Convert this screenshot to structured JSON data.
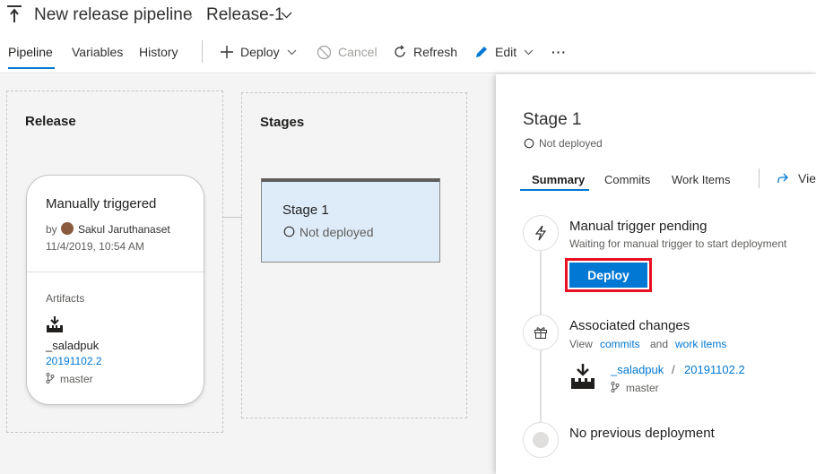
{
  "breadcrumb": {
    "pipeline_name": "New release pipeline",
    "release_name": "Release-1"
  },
  "tabs": [
    "Pipeline",
    "Variables",
    "History"
  ],
  "toolbar": {
    "deploy": "Deploy",
    "cancel": "Cancel",
    "refresh": "Refresh",
    "edit": "Edit",
    "more": "···"
  },
  "release_box": {
    "title": "Release",
    "trigger": "Manually triggered",
    "by_prefix": "by",
    "user": "Sakul Jaruthanaset",
    "timestamp": "11/4/2019, 10:54 AM",
    "artifacts_label": "Artifacts",
    "artifact_name": "_saladpuk",
    "artifact_version": "20191102.2",
    "branch": "master"
  },
  "stages_box": {
    "title": "Stages",
    "stage_name": "Stage 1",
    "stage_status": "Not deployed"
  },
  "panel": {
    "title": "Stage 1",
    "status": "Not deployed",
    "tabs": [
      "Summary",
      "Commits",
      "Work Items"
    ],
    "view_link": "Vie",
    "trigger_title": "Manual trigger pending",
    "trigger_desc": "Waiting for manual trigger to start deployment",
    "deploy_button": "Deploy",
    "changes_title": "Associated changes",
    "changes_view": "View",
    "changes_commits": "commits",
    "changes_and": "and",
    "changes_workitems": "work items",
    "artifact_name": "_saladpuk",
    "artifact_sep": "/",
    "artifact_version": "20191102.2",
    "branch": "master",
    "previous": "No previous deployment"
  },
  "colors": {
    "accent": "#0078d4",
    "highlight": "#e81123",
    "stage_fill": "#deecf9"
  }
}
